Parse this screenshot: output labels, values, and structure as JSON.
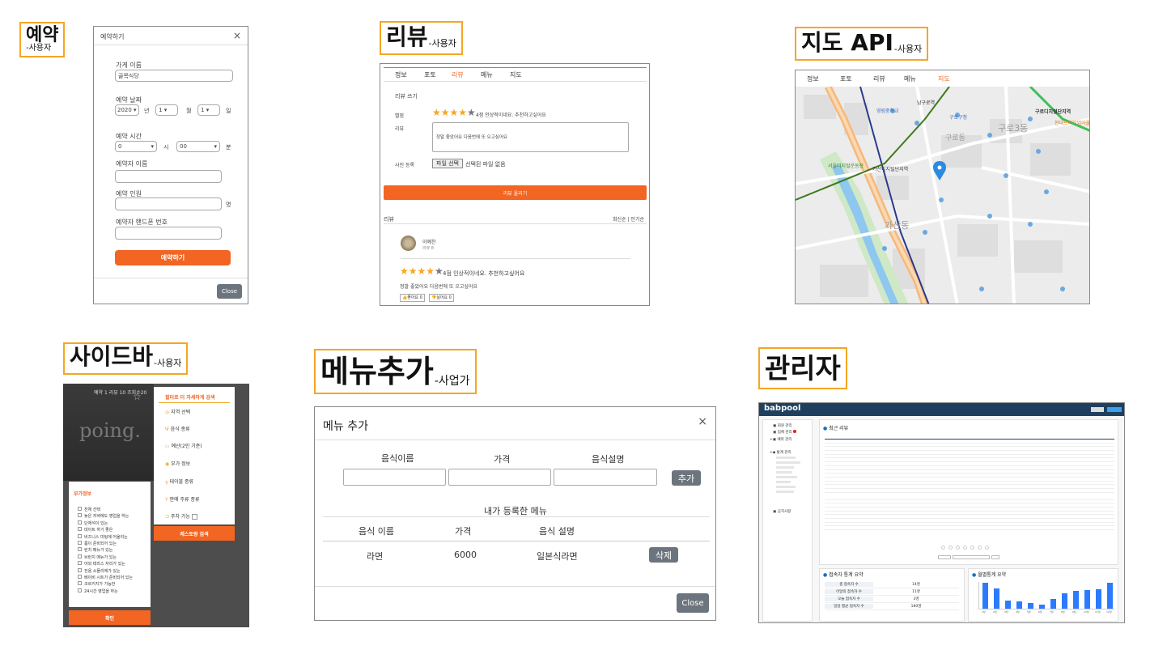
{
  "titles": {
    "reserve": {
      "main": "예약",
      "sub": "-사용자"
    },
    "review": {
      "main": "리뷰",
      "sub": "-사용자"
    },
    "map": {
      "main": "지도 API",
      "sub": "-사용자"
    },
    "sidebar": {
      "main": "사이드바",
      "sub": "-사용자"
    },
    "menu_add": {
      "main": "메뉴추가",
      "sub": "-사업가"
    },
    "admin": {
      "main": "관리자",
      "sub": ""
    }
  },
  "reserve": {
    "header": "예약하기",
    "close_x": "×",
    "store_label": "가게 이름",
    "store_value": "골목식당",
    "date_label": "예약 날짜",
    "year": "2020",
    "year_unit": "년",
    "month": "1",
    "month_unit": "월",
    "day": "1",
    "day_unit": "일",
    "time_label": "예약 시간",
    "hour": "0",
    "hour_unit": "시",
    "minute": "00",
    "minute_unit": "분",
    "name_label": "예약자 이름",
    "people_label": "예약 인원",
    "people_unit": "명",
    "phone_label": "예약자 핸드폰 번호",
    "submit": "예약하기",
    "close": "Close"
  },
  "review": {
    "tabs": [
      "정보",
      "포토",
      "리뷰",
      "메뉴",
      "지도"
    ],
    "active_tab": "리뷰",
    "write_title": "리뷰 쓰기",
    "rating_label": "별점",
    "rating_text": "4점 인상적이네요. 추천하고싶어요",
    "review_label": "리뷰",
    "review_text": "정말 좋았어요 다음번에 또 오고싶어요",
    "photo_label": "사진 등록",
    "file_button": "파일 선택",
    "file_status": "선택된 파일 없음",
    "submit": "리뷰 올리기",
    "list_title": "리뷰",
    "sort": "최신순 | 인기순",
    "author": "이예찬",
    "author_sub": "리뷰 8",
    "post_rating": "4점 인상적이네요. 추천하고싶어요",
    "post_text": "정말 좋았어요 다음번에 또 오고싶어요",
    "like": "좋아요 0",
    "dislike": "싫어요 0",
    "stars": 4
  },
  "map": {
    "tabs": [
      "정보",
      "포토",
      "리뷰",
      "메뉴",
      "지도"
    ],
    "active_tab": "지도",
    "labels": [
      {
        "t": "가산디지털단지역"
      },
      {
        "t": "구로3동"
      },
      {
        "t": "가산동"
      },
      {
        "t": "구로디지털단지역"
      },
      {
        "t": "서울디지털운동장"
      },
      {
        "t": "남구로역"
      },
      {
        "t": "영림중학교"
      },
      {
        "t": "구로구청"
      },
      {
        "t": "현대프리미엄아울렛"
      },
      {
        "t": "구로동"
      }
    ]
  },
  "sidebar": {
    "bg_text": "poing.",
    "bg_top": "예약 1 리뷰 10 조회수20",
    "filter_title": "필터로 더 자세하게 검색",
    "filters": [
      "지역 선택",
      "음식 종류",
      "예산(2인 기준)",
      "부가 정보",
      "테이블 종류",
      "판매 주류 종류",
      "주차 가능"
    ],
    "search_button": "레스토랑 검색",
    "extra_title": "부가정보",
    "extra_items": [
      "전체 선택",
      "늦은 저녁에도 영업을 하는",
      "단체석이 있는",
      "데이트 하기 좋은",
      "비즈니스 미팅에 어울리는",
      "룸이 준비되어 있는",
      "런치 메뉴가 있는",
      "브런치 메뉴가 있는",
      "야외 테라스 자리가 있는",
      "전용 소믈리에가 있는",
      "베이비 시트가 준비되어 있는",
      "코르키지가 가능한",
      "24시간 영업을 하는"
    ],
    "confirm": "확인"
  },
  "menu_add": {
    "header": "메뉴 추가",
    "close_x": "×",
    "col_name": "음식이름",
    "col_price": "가격",
    "col_desc": "음식설명",
    "add_button": "추가",
    "registered_title": "내가 등록한 메뉴",
    "th_name": "음식 이름",
    "th_price": "가격",
    "th_desc": "음식 설명",
    "rows": [
      {
        "name": "라면",
        "price": "6000",
        "desc": "일본식라면",
        "delete": "삭제"
      }
    ],
    "close": "Close"
  },
  "admin": {
    "logo": "babpool",
    "side_items": [
      "회원 관리",
      "업체 관리",
      "예약 관리",
      "통계 관리",
      "공지사항"
    ],
    "recent_review_title": "최근 리뷰",
    "visitor_title": "접속자 통계 요약",
    "monthly_title": "월별통계 요약",
    "visitor_rows": [
      {
        "k": "총 접속자 수",
        "v": "14명"
      },
      {
        "k": "이달의 접속자 수",
        "v": "11명"
      },
      {
        "k": "오늘 접속자 수",
        "v": "3명"
      },
      {
        "k": "일일 평균 접속자 수",
        "v": "180명"
      }
    ],
    "chart_data": {
      "type": "bar",
      "categories": [
        "1월",
        "2월",
        "3월",
        "4월",
        "5월",
        "6월",
        "7월",
        "8월",
        "9월",
        "10월",
        "11월",
        "12월"
      ],
      "values": [
        38,
        30,
        12,
        11,
        8,
        6,
        14,
        22,
        26,
        27,
        28,
        38
      ],
      "ylim": [
        0,
        40
      ],
      "title": "월별통계 요약"
    }
  }
}
